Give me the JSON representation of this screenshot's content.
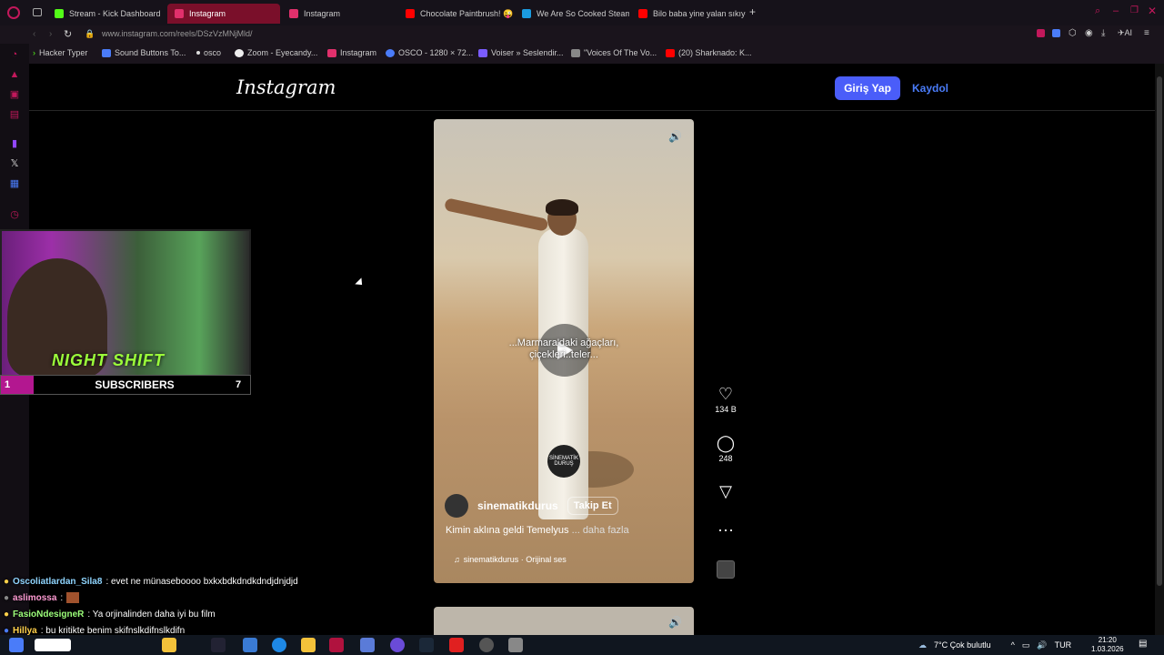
{
  "tabs": [
    {
      "label": "Stream - Kick Dashboard",
      "color": "#53fc18"
    },
    {
      "label": "Instagram",
      "color": "#e1306c",
      "active": true
    },
    {
      "label": "Instagram",
      "color": "#e1306c"
    },
    {
      "label": "Chocolate Paintbrush! 😜 ,",
      "color": "#ff0000"
    },
    {
      "label": "We Are So Cooked Steam",
      "color": "#1b9be0"
    },
    {
      "label": "Bilo baba yine yalan sıkıyo",
      "color": "#ff0000"
    }
  ],
  "address": {
    "url": "www.instagram.com/reels/DSzVzMNjMld/"
  },
  "bookmarks": [
    {
      "label": "Hacker Typer"
    },
    {
      "label": "Sound Buttons To..."
    },
    {
      "label": "osco"
    },
    {
      "label": "Zoom - Eyecandy..."
    },
    {
      "label": "Instagram"
    },
    {
      "label": "OSCO - 1280 × 72..."
    },
    {
      "label": "Voiser » Seslendir..."
    },
    {
      "label": "\"Voices Of The Vo..."
    },
    {
      "label": "(20) Sharknado: K..."
    }
  ],
  "header": {
    "logo": "Instagram",
    "login": "Giriş Yap",
    "signup": "Kaydol"
  },
  "reel": {
    "subtitle": "...Marmara'daki ağaçları, çiçekleri..teler...",
    "watermark": "SİNEMATİK DURUŞ",
    "author": "sinematikdurus",
    "follow": "Takip Et",
    "caption": "Kimin aklına geldi Temelyus",
    "more": "... daha fazla",
    "audio": "sinematikdurus · Orijinal ses"
  },
  "actions": {
    "likes": "134 B",
    "comments": "248"
  },
  "overlay": {
    "stream_logo": "NIGHT SHIFT",
    "subscribers_label": "SUBSCRIBERS",
    "sub_left": "1",
    "sub_right": "7"
  },
  "chat": [
    {
      "user": "Oscoliatlardan_Sila8",
      "text": ": evet ne münaseboooo bxkxbdkdndkdndjdnjdjd",
      "color": "#8fd5ff"
    },
    {
      "user": "aslimossa",
      "text": ":",
      "color": "#ff9bd3"
    },
    {
      "user": "FasioNdesigneR",
      "text": ": Ya orjinalinden daha iyi bu film",
      "color": "#9cff7a"
    },
    {
      "user": "Hillya",
      "text": ": bu kritikte benim skifnslkdifnslkdifn",
      "color": "#ffd04a"
    }
  ],
  "taskbar": {
    "weather": "7°C  Çok bulutlu",
    "lang": "TUR",
    "time": "21:20",
    "date": "1.03.2026"
  }
}
